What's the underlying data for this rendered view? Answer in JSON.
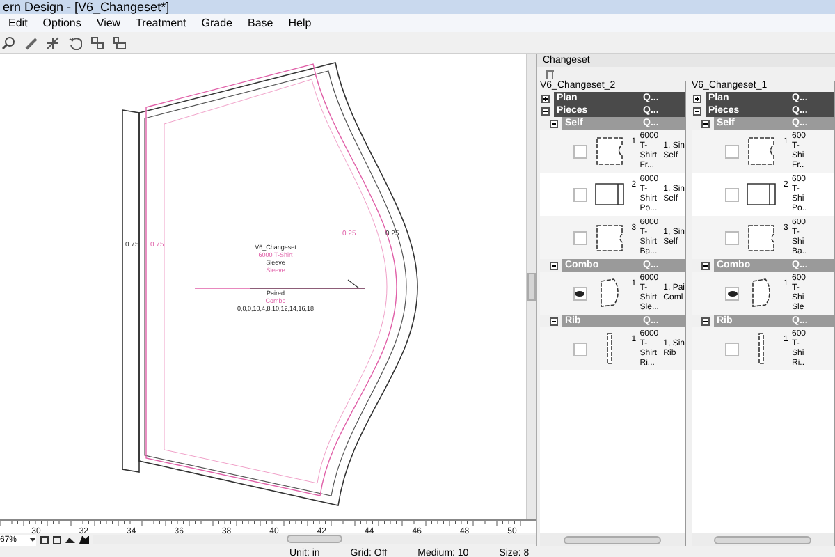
{
  "window": {
    "title": "ern Design - [V6_Changeset*]"
  },
  "menu": [
    "Edit",
    "Options",
    "View",
    "Treatment",
    "Grade",
    "Base",
    "Help"
  ],
  "canvas": {
    "measures": [
      {
        "text": "0.75",
        "kind": "black"
      },
      {
        "text": "0.75",
        "kind": "pink"
      },
      {
        "text": "0.25",
        "kind": "pink"
      },
      {
        "text": "0.25",
        "kind": "black"
      }
    ],
    "annotation": [
      "V6_Changeset",
      "6000 T-Shirt",
      "Sleeve",
      "Sleeve",
      "Paired",
      "Combo",
      "0,0,0,10,4,8,10,12,14,16,18"
    ],
    "ruler": [
      "30",
      "32",
      "34",
      "36",
      "38",
      "40",
      "42",
      "44",
      "46",
      "48",
      "50"
    ],
    "zoom": "67%"
  },
  "changeset": {
    "title": "Changeset",
    "columns": [
      {
        "title": "V6_Changeset_2",
        "rows": [
          {
            "kind": "group",
            "label": "Plan",
            "q": "Q...",
            "expanded": false
          },
          {
            "kind": "group",
            "label": "Pieces",
            "q": "Q...",
            "expanded": true
          },
          {
            "kind": "subgroup",
            "label": "Self",
            "q": "Q...",
            "expanded": true
          },
          {
            "kind": "piece",
            "number": "1",
            "visible": false,
            "col_a": [
              "6000",
              "T-",
              "Shirt",
              "Fr..."
            ],
            "col_b": [
              "1, Sin",
              "Self"
            ]
          },
          {
            "kind": "piece",
            "number": "2",
            "visible": false,
            "col_a": [
              "6000",
              "T-",
              "Shirt",
              "Po..."
            ],
            "col_b": [
              "1, Sin",
              "Self"
            ]
          },
          {
            "kind": "piece",
            "number": "3",
            "visible": false,
            "col_a": [
              "6000",
              "T-",
              "Shirt",
              "Ba..."
            ],
            "col_b": [
              "1, Sin",
              "Self"
            ]
          },
          {
            "kind": "subgroup",
            "label": "Combo",
            "q": "Q...",
            "expanded": true
          },
          {
            "kind": "piece",
            "number": "1",
            "visible": true,
            "col_a": [
              "6000",
              "T-",
              "Shirt",
              "Sle..."
            ],
            "col_b": [
              "1, Pai",
              "Coml"
            ]
          },
          {
            "kind": "subgroup",
            "label": "Rib",
            "q": "Q...",
            "expanded": true
          },
          {
            "kind": "piece",
            "number": "1",
            "visible": false,
            "col_a": [
              "6000",
              "T-",
              "Shirt",
              "Ri..."
            ],
            "col_b": [
              "1, Sin",
              "Rib"
            ]
          }
        ]
      },
      {
        "title": "V6_Changeset_1",
        "rows": [
          {
            "kind": "group",
            "label": "Plan",
            "q": "Q...",
            "expanded": false
          },
          {
            "kind": "group",
            "label": "Pieces",
            "q": "Q...",
            "expanded": true
          },
          {
            "kind": "subgroup",
            "label": "Self",
            "q": "Q...",
            "expanded": true
          },
          {
            "kind": "piece",
            "number": "1",
            "visible": false,
            "col_a": [
              "600",
              "T-",
              "Shi",
              "Fr.."
            ]
          },
          {
            "kind": "piece",
            "number": "2",
            "visible": false,
            "col_a": [
              "600",
              "T-",
              "Shi",
              "Po.."
            ]
          },
          {
            "kind": "piece",
            "number": "3",
            "visible": false,
            "col_a": [
              "600",
              "T-",
              "Shi",
              "Ba.."
            ]
          },
          {
            "kind": "subgroup",
            "label": "Combo",
            "q": "Q...",
            "expanded": true
          },
          {
            "kind": "piece",
            "number": "1",
            "visible": true,
            "col_a": [
              "600",
              "T-",
              "Shi",
              "Sle"
            ]
          },
          {
            "kind": "subgroup",
            "label": "Rib",
            "q": "Q...",
            "expanded": true
          },
          {
            "kind": "piece",
            "number": "1",
            "visible": false,
            "col_a": [
              "600",
              "T-",
              "Shi",
              "Ri.."
            ]
          }
        ]
      }
    ]
  },
  "status_bar": [
    "Unit: in",
    "Grid: Off",
    "Medium: 10",
    "Size: 8"
  ]
}
